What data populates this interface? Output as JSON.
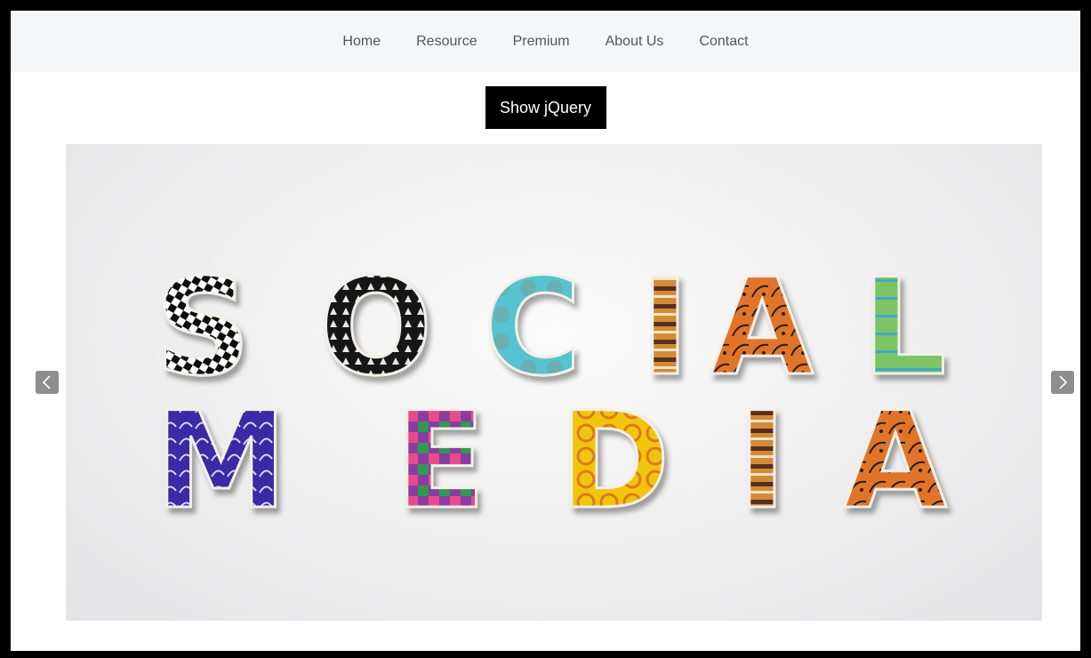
{
  "nav": {
    "items": [
      {
        "label": "Home"
      },
      {
        "label": "Resource"
      },
      {
        "label": "Premium"
      },
      {
        "label": "About Us"
      },
      {
        "label": "Contact"
      }
    ]
  },
  "button": {
    "label": "Show jQuery"
  },
  "slider": {
    "slide_text_line1": "SOCIAL",
    "slide_text_line2": "MEDIA",
    "prev_icon": "chevron-left-icon",
    "next_icon": "chevron-right-icon"
  },
  "colors": {
    "nav_bg": "#f4f6f8",
    "button_bg": "#000000",
    "arrow_bg": "#8e8e8e"
  }
}
